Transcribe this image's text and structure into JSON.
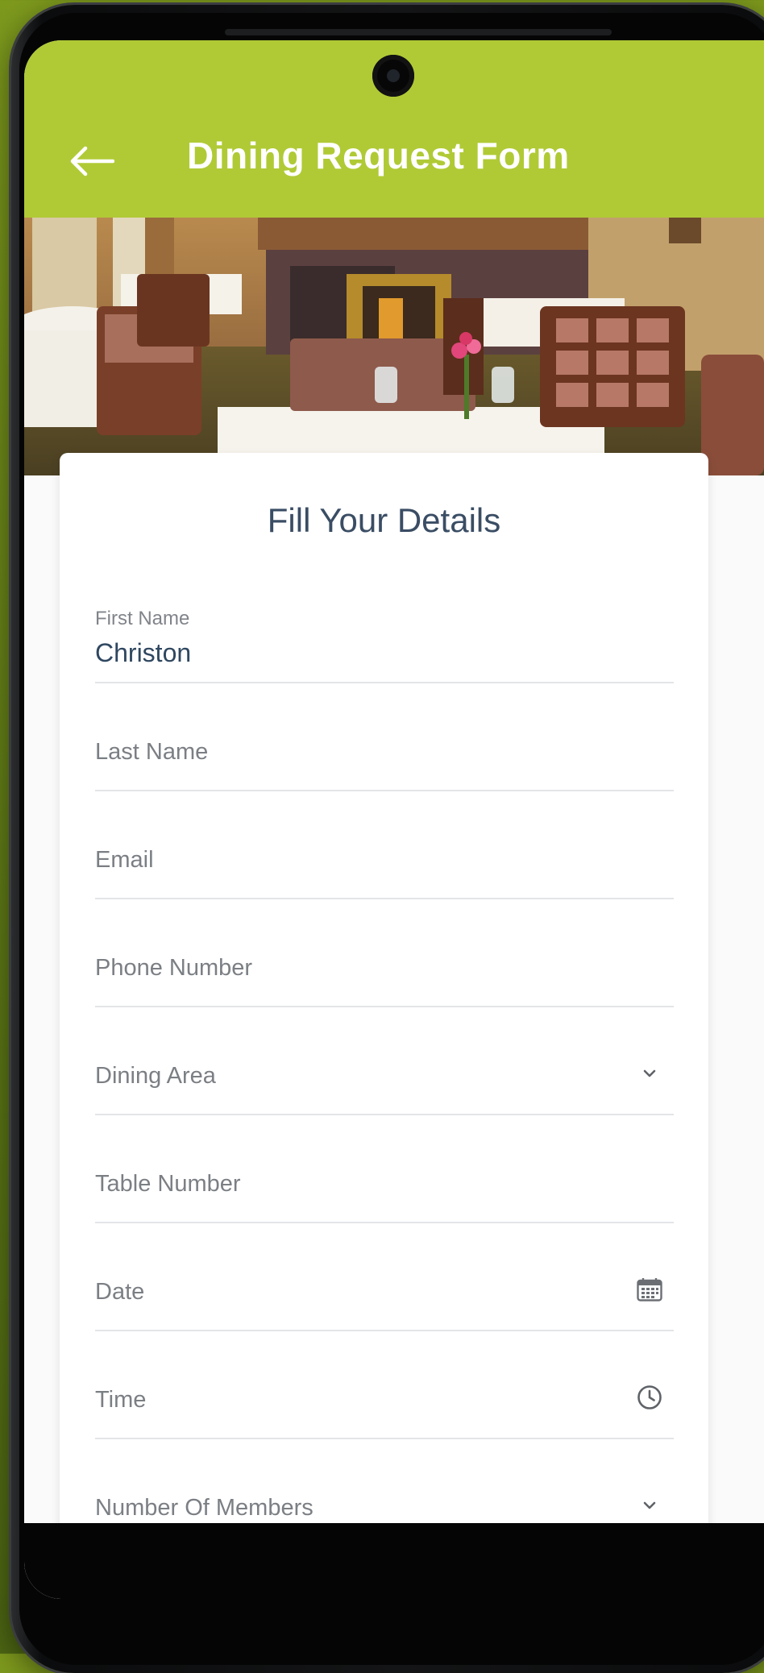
{
  "header": {
    "title": "Dining Request Form",
    "back_icon": "arrow-left-icon",
    "background_color": "#b0ca36"
  },
  "hero_image": {
    "description_icon": "restaurant-photo"
  },
  "form": {
    "heading": "Fill Your Details",
    "fields": [
      {
        "label": "First Name",
        "value": "Christon"
      },
      {
        "placeholder": "Last Name"
      },
      {
        "placeholder": "Email"
      },
      {
        "placeholder": "Phone Number"
      },
      {
        "placeholder": "Dining Area",
        "trailing_icon": "chevron-down-icon"
      },
      {
        "placeholder": "Table Number"
      },
      {
        "placeholder": "Date",
        "trailing_icon": "calendar-icon"
      },
      {
        "placeholder": "Time",
        "trailing_icon": "clock-icon"
      },
      {
        "placeholder": "Number Of Members",
        "trailing_icon": "chevron-down-icon"
      }
    ]
  },
  "colors": {
    "accent": "#b0ca36",
    "text_primary": "#2f4760",
    "placeholder": "#7b7f84",
    "divider": "#e3e5e8"
  }
}
